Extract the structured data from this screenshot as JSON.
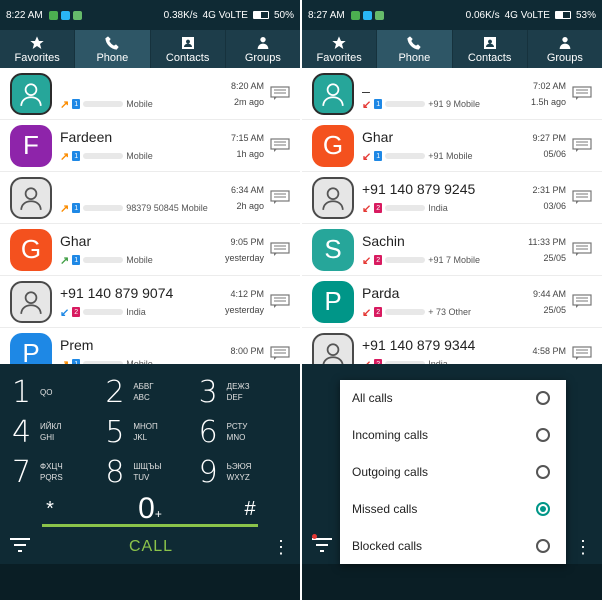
{
  "left": {
    "status": {
      "time": "8:22 AM",
      "speed": "0.38K/s",
      "network": "4G VoLTE",
      "battery": "50%"
    },
    "tabs": [
      {
        "label": "Favorites",
        "icon": "star-icon"
      },
      {
        "label": "Phone",
        "icon": "phone-icon"
      },
      {
        "label": "Contacts",
        "icon": "contact-card-icon"
      },
      {
        "label": "Groups",
        "icon": "group-icon"
      }
    ],
    "calls": [
      {
        "avatar": "",
        "avatar_color": "#26a69a",
        "photo": true,
        "name": "",
        "direction": "outgoing",
        "sim": "1",
        "number": "Mobile",
        "time": "8:20 AM",
        "ago": "2m ago"
      },
      {
        "avatar": "F",
        "avatar_color": "#8e24aa",
        "photo": false,
        "name": "Fardeen",
        "direction": "outgoing",
        "sim": "1",
        "number": "Mobile",
        "time": "7:15 AM",
        "ago": "1h ago"
      },
      {
        "avatar": "",
        "avatar_color": "#e6e6e6",
        "photo": true,
        "name": "",
        "direction": "outgoing",
        "sim": "1",
        "number": "98379 50845 Mobile",
        "time": "6:34 AM",
        "ago": "2h ago"
      },
      {
        "avatar": "G",
        "avatar_color": "#f4511e",
        "photo": false,
        "name": "Ghar",
        "direction": "outgoing-green",
        "sim": "1",
        "number": "Mobile",
        "time": "9:05 PM",
        "ago": "yesterday"
      },
      {
        "avatar": "",
        "avatar_color": "#e6e6e6",
        "photo": true,
        "name": "+91 140 879 9074",
        "direction": "incoming",
        "sim": "2",
        "number": "India",
        "time": "4:12 PM",
        "ago": "yesterday"
      },
      {
        "avatar": "P",
        "avatar_color": "#1e88e5",
        "photo": false,
        "name": "Prem",
        "direction": "outgoing",
        "sim": "1",
        "number": "Mobile",
        "time": "8:00 PM",
        "ago": ""
      }
    ],
    "keys": [
      {
        "num": "1",
        "l1": "QO",
        "l2": ""
      },
      {
        "num": "2",
        "l1": "АБВГ",
        "l2": "ABC"
      },
      {
        "num": "3",
        "l1": "ДЕЖЗ",
        "l2": "DEF"
      },
      {
        "num": "4",
        "l1": "ИЙКЛ",
        "l2": "GHI"
      },
      {
        "num": "5",
        "l1": "МНОП",
        "l2": "JKL"
      },
      {
        "num": "6",
        "l1": "РСТУ",
        "l2": "MNO"
      },
      {
        "num": "7",
        "l1": "ФХЦЧ",
        "l2": "PQRS"
      },
      {
        "num": "8",
        "l1": "ШЩЪЫ",
        "l2": "TUV"
      },
      {
        "num": "9",
        "l1": "ЬЭЮЯ",
        "l2": "WXYZ"
      }
    ],
    "star": "*",
    "zero": "0",
    "plus": "+",
    "hash": "#",
    "call_label": "CALL",
    "more": "⋮"
  },
  "right": {
    "status": {
      "time": "8:27 AM",
      "speed": "0.06K/s",
      "network": "4G VoLTE",
      "battery": "53%"
    },
    "calls": [
      {
        "avatar": "",
        "avatar_color": "#26a69a",
        "photo": true,
        "name": "_",
        "direction": "missed",
        "sim": "1",
        "number": "+91 9 Mobile",
        "time": "7:02 AM",
        "ago": "1.5h ago"
      },
      {
        "avatar": "G",
        "avatar_color": "#f4511e",
        "photo": false,
        "name": "Ghar",
        "direction": "missed",
        "sim": "1",
        "number": "+91 Mobile",
        "time": "9:27 PM",
        "ago": "05/06"
      },
      {
        "avatar": "",
        "avatar_color": "#e6e6e6",
        "photo": true,
        "name": "+91 140 879 9245",
        "direction": "missed",
        "sim": "2",
        "number": "India",
        "time": "2:31 PM",
        "ago": "03/06"
      },
      {
        "avatar": "S",
        "avatar_color": "#26a69a",
        "photo": false,
        "name": "Sachin",
        "direction": "missed",
        "sim": "2",
        "number": "+91 7 Mobile",
        "time": "11:33 PM",
        "ago": "25/05"
      },
      {
        "avatar": "P",
        "avatar_color": "#009688",
        "photo": false,
        "name": "Parda",
        "direction": "missed",
        "sim": "2",
        "number": "+ 73 Other",
        "time": "9:44 AM",
        "ago": "25/05"
      },
      {
        "avatar": "",
        "avatar_color": "#e6e6e6",
        "photo": true,
        "name": "+91 140 879 9344",
        "direction": "missed",
        "sim": "2",
        "number": "India",
        "time": "4:58 PM",
        "ago": ""
      }
    ],
    "filter_menu": [
      {
        "label": "All calls",
        "selected": false
      },
      {
        "label": "Incoming calls",
        "selected": false
      },
      {
        "label": "Outgoing calls",
        "selected": false
      },
      {
        "label": "Missed calls",
        "selected": true
      },
      {
        "label": "Blocked calls",
        "selected": false
      }
    ]
  }
}
